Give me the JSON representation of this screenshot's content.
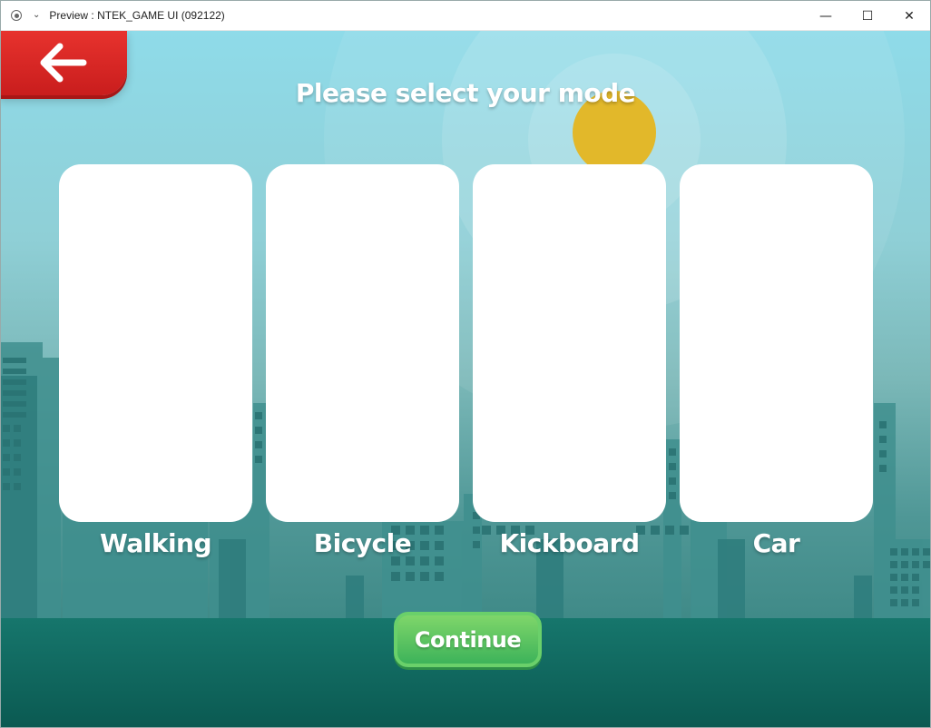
{
  "window": {
    "title": "Preview : NTEK_GAME UI (092122)",
    "controls": {
      "minimize": "—",
      "maximize": "☐",
      "close": "✕"
    }
  },
  "game": {
    "heading": "Please select your mode",
    "modes": [
      {
        "label": "Walking"
      },
      {
        "label": "Bicycle"
      },
      {
        "label": "Kickboard"
      },
      {
        "label": "Car"
      }
    ],
    "continue_label": "Continue"
  },
  "colors": {
    "back_button": "#d92626",
    "continue_button": "#4cc35e",
    "sun": "#e2b82a",
    "ground": "#0f6a61"
  },
  "icons": {
    "back": "arrow-left-icon",
    "app": "app-record-icon",
    "menu": "chevron-down-icon"
  }
}
